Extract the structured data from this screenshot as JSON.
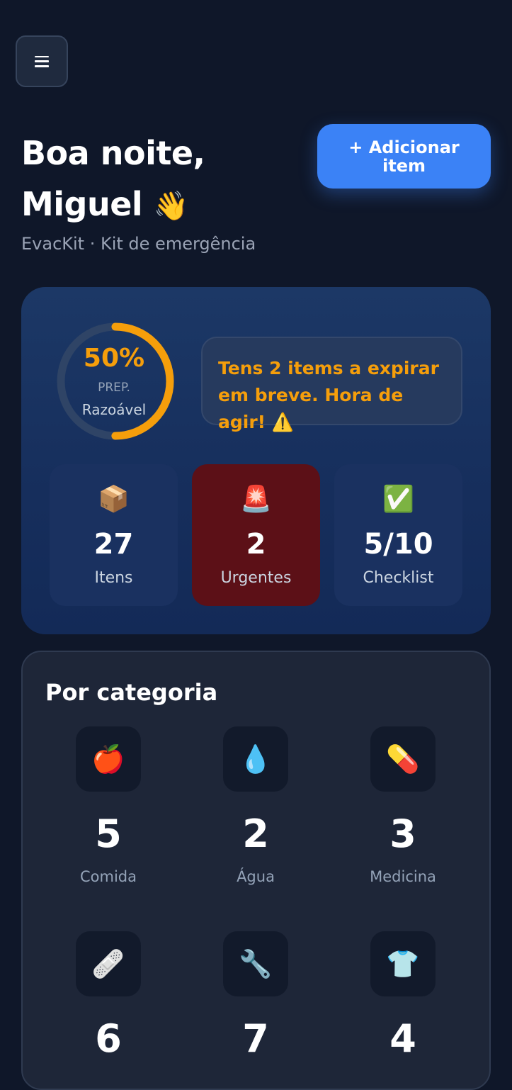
{
  "header": {
    "menu_icon": "hamburger-menu-icon",
    "greeting_line1": "Boa noite,",
    "greeting_line2": "Miguel",
    "wave_emoji": "👋",
    "subtitle": "EvacKit · Kit de emergência",
    "add_button_label": "+ Adicionar item"
  },
  "summary": {
    "preparedness_percent": 50,
    "preparedness_text": "50%",
    "preparedness_label": "PREP.",
    "preparedness_status": "Razoável",
    "ring_color": "#f59e0b",
    "alert_text": "Tens 2 items a expirar em breve. Hora de agir! ⚠️",
    "stats": [
      {
        "emoji": "📦",
        "value": "27",
        "label": "Itens"
      },
      {
        "emoji": "🚨",
        "value": "2",
        "label": "Urgentes"
      },
      {
        "emoji": "✅",
        "value": "5/10",
        "label": "Checklist"
      }
    ]
  },
  "categories": {
    "title": "Por categoria",
    "items": [
      {
        "emoji": "🍎",
        "count": "5",
        "name": "Comida"
      },
      {
        "emoji": "💧",
        "count": "2",
        "name": "Água"
      },
      {
        "emoji": "💊",
        "count": "3",
        "name": "Medicina"
      },
      {
        "emoji": "🩹",
        "count": "6",
        "name": ""
      },
      {
        "emoji": "🔧",
        "count": "7",
        "name": ""
      },
      {
        "emoji": "👕",
        "count": "4",
        "name": ""
      }
    ]
  },
  "colors": {
    "background": "#0f1729",
    "accent": "#3b82f6",
    "warning": "#f59e0b",
    "urgent": "#5c1017"
  }
}
